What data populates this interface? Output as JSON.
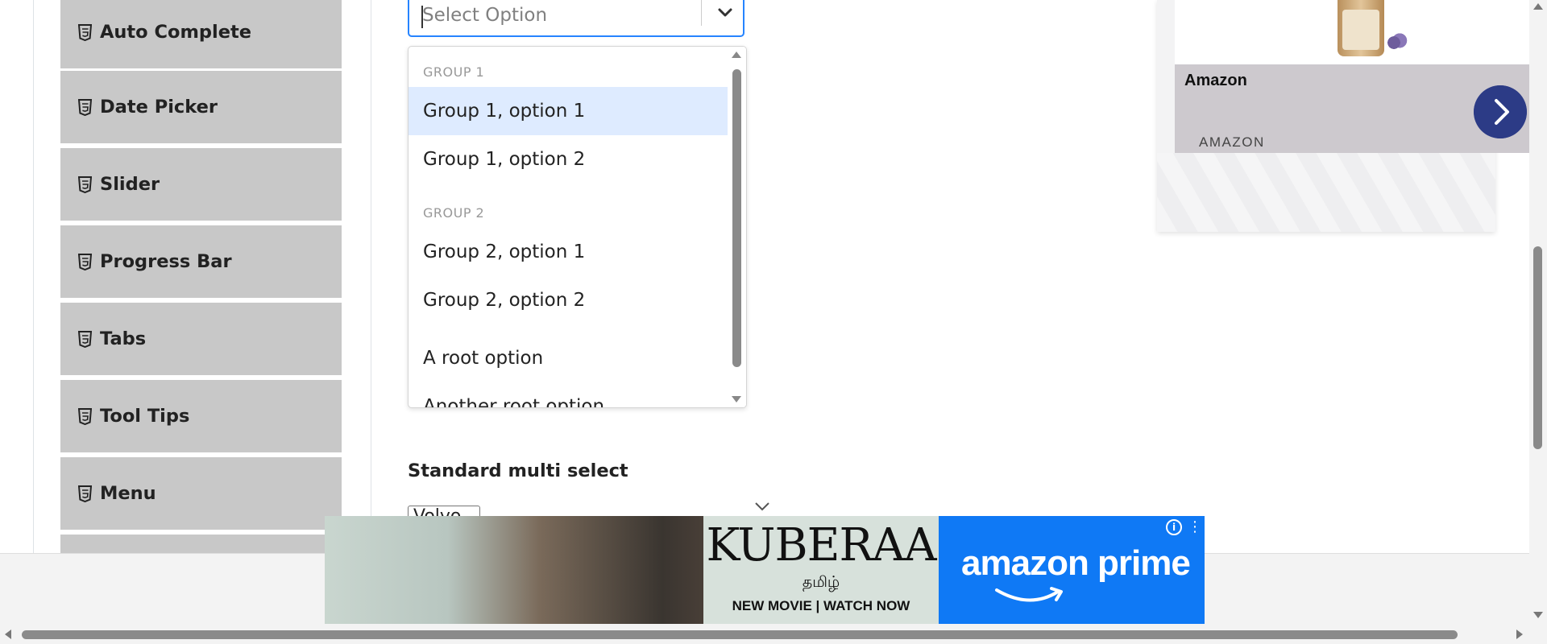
{
  "sidebar": {
    "items": [
      {
        "label": "Auto Complete",
        "icon": "html5-icon"
      },
      {
        "label": "Date Picker",
        "icon": "html5-icon"
      },
      {
        "label": "Slider",
        "icon": "html5-icon"
      },
      {
        "label": "Progress Bar",
        "icon": "html5-icon"
      },
      {
        "label": "Tabs",
        "icon": "html5-icon"
      },
      {
        "label": "Tool Tips",
        "icon": "html5-icon"
      },
      {
        "label": "Menu",
        "icon": "html5-icon"
      }
    ]
  },
  "select": {
    "placeholder": "Select Option",
    "menu": {
      "group1": {
        "heading": "GROUP 1",
        "options": [
          "Group 1, option 1",
          "Group 1, option 2"
        ]
      },
      "group2": {
        "heading": "GROUP 2",
        "options": [
          "Group 2, option 1",
          "Group 2, option 2"
        ]
      },
      "root_options": [
        "A root option",
        "Another root option"
      ],
      "focused_option": "Group 1, option 1"
    },
    "accent_color": "#2684ff",
    "focus_color": "#deebff"
  },
  "multi_select": {
    "label": "Standard multi select",
    "value": "Volvo"
  },
  "ad_card": {
    "title": "Amazon",
    "brand": "AMAZON",
    "button_icon": "chevron-right-icon",
    "button_color": "#2c3b86"
  },
  "bottom_ad": {
    "movie_title": "KUBERAA",
    "language": "தமிழ்",
    "tagline": "NEW MOVIE | WATCH NOW",
    "brand": "amazon prime",
    "background_color": "#0f79f5"
  }
}
